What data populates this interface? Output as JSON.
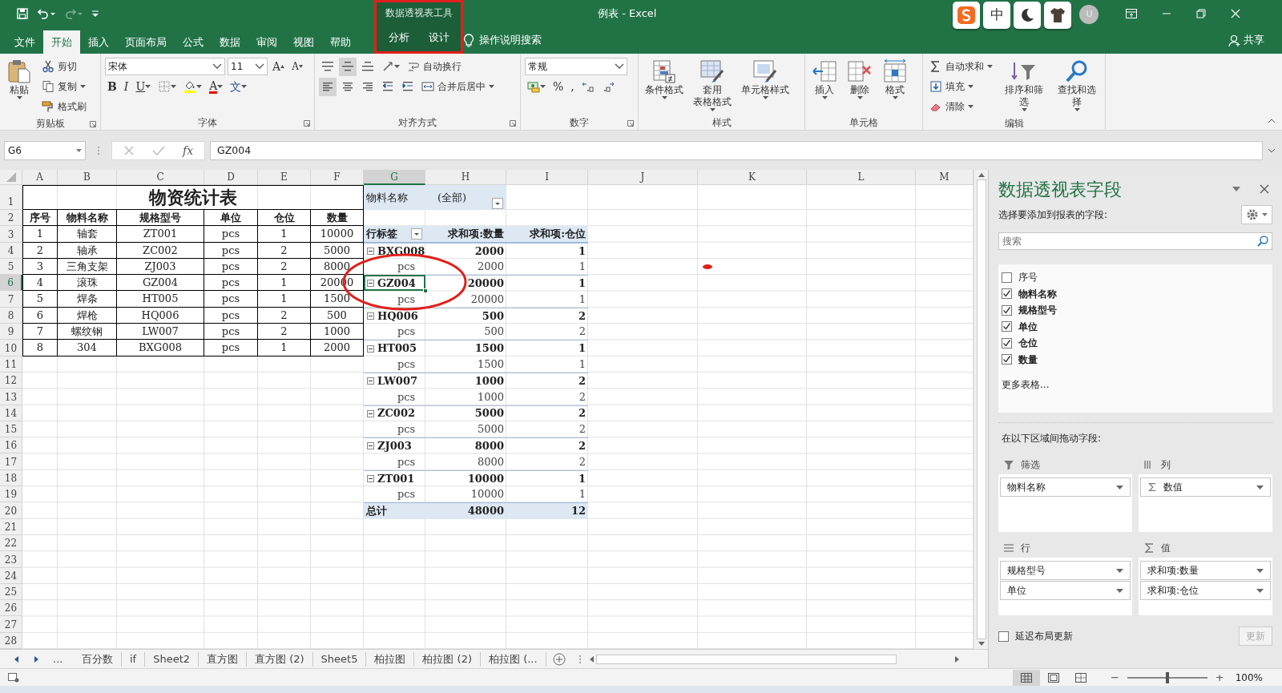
{
  "window": {
    "title": "例表 - Excel"
  },
  "context_tabs": {
    "label": "数据透视表工具",
    "tabs": [
      {
        "label": "分析",
        "selected": false
      },
      {
        "label": "设计",
        "selected": false
      }
    ]
  },
  "ribbon_tabs": [
    {
      "label": "文件",
      "selected": false
    },
    {
      "label": "开始",
      "selected": true
    },
    {
      "label": "插入",
      "selected": false
    },
    {
      "label": "页面布局",
      "selected": false
    },
    {
      "label": "公式",
      "selected": false
    },
    {
      "label": "数据",
      "selected": false
    },
    {
      "label": "审阅",
      "selected": false
    },
    {
      "label": "视图",
      "selected": false
    },
    {
      "label": "帮助",
      "selected": false
    }
  ],
  "tell_me": "操作说明搜索",
  "ime_toolbar": {
    "mode_key": "中",
    "avatar": "U"
  },
  "share": "共享",
  "ribbon_groups": [
    {
      "label": "剪贴板",
      "launcher": true,
      "columns": [
        [
          [
            {
              "kind": "large",
              "label": "粘贴",
              "caret": true
            }
          ]
        ],
        [
          [
            {
              "kind": "small",
              "label": "剪切"
            }
          ],
          [
            {
              "kind": "small",
              "label": "复制",
              "caret": true
            }
          ],
          [
            {
              "kind": "small",
              "label": "格式刷"
            }
          ]
        ]
      ]
    },
    {
      "label": "字体",
      "launcher": true,
      "columns": [
        [
          [
            {
              "kind": "combo",
              "value": "宋体"
            },
            {
              "kind": "combo",
              "value": "11"
            },
            {
              "kind": "grow",
              "label": "A"
            },
            {
              "kind": "shrink",
              "label": "A"
            }
          ],
          [
            {
              "kind": "bold",
              "label": "B"
            },
            {
              "kind": "italic",
              "label": "I"
            },
            {
              "kind": "underline",
              "label": "U",
              "caret": true
            },
            {
              "kind": "icon",
              "caret": true
            },
            {
              "kind": "icon",
              "caret": true
            },
            {
              "kind": "font_color",
              "label": "A",
              "caret": true
            },
            {
              "kind": "phonetic",
              "label": "文",
              "caret": true
            }
          ]
        ]
      ]
    },
    {
      "label": "对齐方式",
      "launcher": true,
      "columns": [
        [
          [
            {
              "kind": "toggle",
              "selected": false
            },
            {
              "kind": "toggle",
              "selected": true
            },
            {
              "kind": "toggle",
              "selected": false
            },
            {
              "kind": "icon",
              "caret": true
            },
            {
              "kind": "small",
              "label": "自动换行"
            }
          ],
          [
            {
              "kind": "toggle",
              "selected": true
            },
            {
              "kind": "toggle",
              "selected": false
            },
            {
              "kind": "toggle",
              "selected": false
            },
            {
              "kind": "icon"
            },
            {
              "kind": "icon"
            },
            {
              "kind": "small",
              "label": "合并后居中",
              "caret": true
            }
          ]
        ]
      ]
    },
    {
      "label": "数字",
      "launcher": true,
      "columns": [
        [
          [
            {
              "kind": "combo",
              "value": "常规"
            }
          ],
          [
            {
              "kind": "icon",
              "caret": true
            },
            {
              "kind": "percent",
              "label": "%"
            },
            {
              "kind": "comma",
              "label": ","
            },
            {
              "kind": "icon"
            },
            {
              "kind": "icon"
            }
          ]
        ]
      ]
    },
    {
      "label": "样式",
      "columns": [
        [
          [
            {
              "kind": "large",
              "label": "条件格式",
              "caret": true
            }
          ]
        ],
        [
          [
            {
              "kind": "large",
              "lines": [
                "套用",
                "表格格式"
              ],
              "caret": true
            }
          ]
        ],
        [
          [
            {
              "kind": "large",
              "label": "单元格样式",
              "caret": true
            }
          ]
        ]
      ]
    },
    {
      "label": "单元格",
      "columns": [
        [
          [
            {
              "kind": "large",
              "label": "插入",
              "caret": true
            }
          ]
        ],
        [
          [
            {
              "kind": "large",
              "label": "删除",
              "caret": true
            }
          ]
        ],
        [
          [
            {
              "kind": "large",
              "label": "格式",
              "caret": true
            }
          ]
        ]
      ]
    },
    {
      "label": "编辑",
      "columns": [
        [
          [
            {
              "kind": "small",
              "label": "自动求和",
              "caret": true
            }
          ],
          [
            {
              "kind": "small",
              "label": "填充",
              "caret": true
            }
          ],
          [
            {
              "kind": "small",
              "label": "清除",
              "caret": true
            }
          ]
        ],
        [
          [
            {
              "kind": "large",
              "label": "排序和筛选",
              "caret": true
            }
          ]
        ],
        [
          [
            {
              "kind": "large",
              "label": "查找和选择",
              "caret": true
            }
          ]
        ]
      ]
    }
  ],
  "formula_bar": {
    "name_box": "G6",
    "fx": "fx",
    "formula": "GZ004"
  },
  "columns": [
    {
      "label": "A",
      "selected": false
    },
    {
      "label": "B",
      "selected": false
    },
    {
      "label": "C",
      "selected": false
    },
    {
      "label": "D",
      "selected": false
    },
    {
      "label": "E",
      "selected": false
    },
    {
      "label": "F",
      "selected": false
    },
    {
      "label": "G",
      "selected": true
    },
    {
      "label": "H",
      "selected": false
    },
    {
      "label": "I",
      "selected": false
    },
    {
      "label": "J",
      "selected": false
    },
    {
      "label": "K",
      "selected": false
    },
    {
      "label": "L",
      "selected": false
    },
    {
      "label": "M",
      "selected": false
    }
  ],
  "rows": [
    {
      "label": "1",
      "selected": false
    },
    {
      "label": "2",
      "selected": false
    },
    {
      "label": "3",
      "selected": false
    },
    {
      "label": "4",
      "selected": false
    },
    {
      "label": "5",
      "selected": false
    },
    {
      "label": "6",
      "selected": true
    },
    {
      "label": "7",
      "selected": false
    },
    {
      "label": "8",
      "selected": false
    },
    {
      "label": "9",
      "selected": false
    },
    {
      "label": "10",
      "selected": false
    },
    {
      "label": "11",
      "selected": false
    },
    {
      "label": "12",
      "selected": false
    },
    {
      "label": "13",
      "selected": false
    },
    {
      "label": "14",
      "selected": false
    },
    {
      "label": "15",
      "selected": false
    },
    {
      "label": "16",
      "selected": false
    },
    {
      "label": "17",
      "selected": false
    },
    {
      "label": "18",
      "selected": false
    },
    {
      "label": "19",
      "selected": false
    },
    {
      "label": "20",
      "selected": false
    },
    {
      "label": "21",
      "selected": false
    },
    {
      "label": "22",
      "selected": false
    },
    {
      "label": "23",
      "selected": false
    },
    {
      "label": "24",
      "selected": false
    },
    {
      "label": "25",
      "selected": false
    },
    {
      "label": "26",
      "selected": false
    },
    {
      "label": "27",
      "selected": false
    },
    {
      "label": "28",
      "selected": false
    }
  ],
  "stock_table": {
    "title": "物资统计表",
    "headers": [
      "序号",
      "物料名称",
      "规格型号",
      "单位",
      "仓位",
      "数量"
    ],
    "rows": [
      [
        "1",
        "轴套",
        "ZT001",
        "pcs",
        "1",
        "10000"
      ],
      [
        "2",
        "轴承",
        "ZC002",
        "pcs",
        "2",
        "5000"
      ],
      [
        "3",
        "三角支架",
        "ZJ003",
        "pcs",
        "2",
        "8000"
      ],
      [
        "4",
        "滚珠",
        "GZ004",
        "pcs",
        "1",
        "20000"
      ],
      [
        "5",
        "焊条",
        "HT005",
        "pcs",
        "1",
        "1500"
      ],
      [
        "6",
        "焊枪",
        "HQ006",
        "pcs",
        "2",
        "500"
      ],
      [
        "7",
        "螺纹钢",
        "LW007",
        "pcs",
        "2",
        "1000"
      ],
      [
        "8",
        "304",
        "BXG008",
        "pcs",
        "1",
        "2000"
      ]
    ]
  },
  "pivot": {
    "filter": {
      "field": "物料名称",
      "value": "(全部)"
    },
    "headers": [
      "行标签",
      "求和项:数量",
      "求和项:仓位"
    ],
    "groups": [
      {
        "label": "BXG008",
        "quantity": "2000",
        "slots": "1",
        "expanded": true,
        "children": [
          {
            "label": "pcs",
            "quantity": "2000",
            "slots": "1"
          }
        ]
      },
      {
        "label": "GZ004",
        "quantity": "20000",
        "slots": "1",
        "expanded": true,
        "children": [
          {
            "label": "pcs",
            "quantity": "20000",
            "slots": "1"
          }
        ]
      },
      {
        "label": "HQ006",
        "quantity": "500",
        "slots": "2",
        "expanded": true,
        "children": [
          {
            "label": "pcs",
            "quantity": "500",
            "slots": "2"
          }
        ]
      },
      {
        "label": "HT005",
        "quantity": "1500",
        "slots": "1",
        "expanded": true,
        "children": [
          {
            "label": "pcs",
            "quantity": "1500",
            "slots": "1"
          }
        ]
      },
      {
        "label": "LW007",
        "quantity": "1000",
        "slots": "2",
        "expanded": true,
        "children": [
          {
            "label": "pcs",
            "quantity": "1000",
            "slots": "2"
          }
        ]
      },
      {
        "label": "ZC002",
        "quantity": "5000",
        "slots": "2",
        "expanded": true,
        "children": [
          {
            "label": "pcs",
            "quantity": "5000",
            "slots": "2"
          }
        ]
      },
      {
        "label": "ZJ003",
        "quantity": "8000",
        "slots": "2",
        "expanded": true,
        "children": [
          {
            "label": "pcs",
            "quantity": "8000",
            "slots": "2"
          }
        ]
      },
      {
        "label": "ZT001",
        "quantity": "10000",
        "slots": "1",
        "expanded": true,
        "children": [
          {
            "label": "pcs",
            "quantity": "10000",
            "slots": "1"
          }
        ]
      }
    ],
    "total": {
      "label": "总计",
      "quantity": "48000",
      "slots": "12"
    }
  },
  "markup": [
    {
      "kind": "box"
    },
    {
      "kind": "ellipse"
    },
    {
      "kind": "dot"
    }
  ],
  "sheet_tabs": {
    "overflow": "...",
    "tabs": [
      "百分数",
      "if",
      "Sheet2",
      "直方图",
      "直方图 (2)",
      "Sheet5",
      "柏拉图",
      "柏拉图 (2)",
      "柏拉图 (..."
    ]
  },
  "status_bar": {
    "views": [
      {
        "selected": true
      },
      {
        "selected": false
      },
      {
        "selected": false
      }
    ],
    "zoom_out": "−",
    "zoom_in": "+",
    "zoom_slider": {
      "level": 0.5
    },
    "zoom": "100%"
  },
  "field_pane": {
    "title": "数据透视表字段",
    "subtitle": "选择要添加到报表的字段:",
    "search": {
      "placeholder": "搜索"
    },
    "fields": [
      {
        "label": "序号",
        "checked": false
      },
      {
        "label": "物料名称",
        "checked": true
      },
      {
        "label": "规格型号",
        "checked": true
      },
      {
        "label": "单位",
        "checked": true
      },
      {
        "label": "仓位",
        "checked": true
      },
      {
        "label": "数量",
        "checked": true
      }
    ],
    "more_tables": "更多表格...",
    "drag_hint": "在以下区域间拖动字段:",
    "areas": [
      {
        "title": "筛选",
        "items": [
          {
            "label": "物料名称",
            "kind": "field"
          }
        ]
      },
      {
        "title": "列",
        "items": [
          {
            "label": "数值",
            "kind": "values"
          }
        ]
      },
      {
        "title": "行",
        "items": [
          {
            "label": "规格型号",
            "kind": "field"
          },
          {
            "label": "单位",
            "kind": "field"
          }
        ]
      },
      {
        "title": "值",
        "items": [
          {
            "label": "求和项:数量",
            "kind": "field"
          },
          {
            "label": "求和项:仓位",
            "kind": "field"
          }
        ]
      }
    ],
    "defer": {
      "label": "延迟布局更新",
      "checked": false
    },
    "update_button": {
      "label": "更新",
      "disabled": true
    }
  }
}
